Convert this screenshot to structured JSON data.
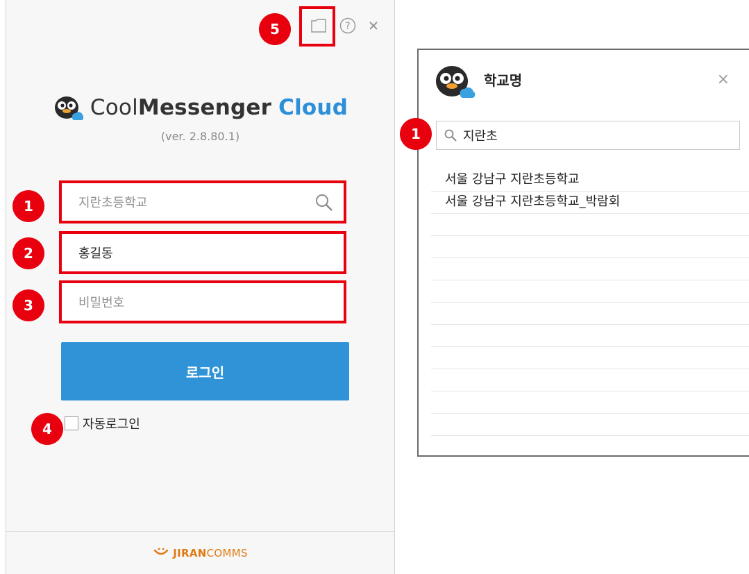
{
  "login": {
    "app_name": {
      "light": "Cool",
      "bold": "Messenger",
      "accent": "Cloud"
    },
    "version": "(ver. 2.8.80.1)",
    "school_field": {
      "value": "지란초등학교"
    },
    "name_field": {
      "value": "홍길동"
    },
    "password_field": {
      "placeholder": "비밀번호"
    },
    "login_button": "로그인",
    "auto_login_label": "자동로그인",
    "footer": {
      "brand_bold": "JIRAN",
      "brand_light": "COMMS"
    }
  },
  "popup": {
    "title": "학교명",
    "close": "×",
    "search_value": "지란초",
    "results": [
      "서울 강남구 지란초등학교",
      "서울 강남구 지란초등학교_박람회"
    ]
  },
  "badges": {
    "school": "1",
    "name": "2",
    "password": "3",
    "auto_login": "4",
    "settings": "5",
    "popup_search": "1"
  },
  "colors": {
    "highlight": "#e8000e",
    "button": "#3093d7",
    "cloud": "#2d8fd8",
    "footer_brand": "#e07a12"
  }
}
